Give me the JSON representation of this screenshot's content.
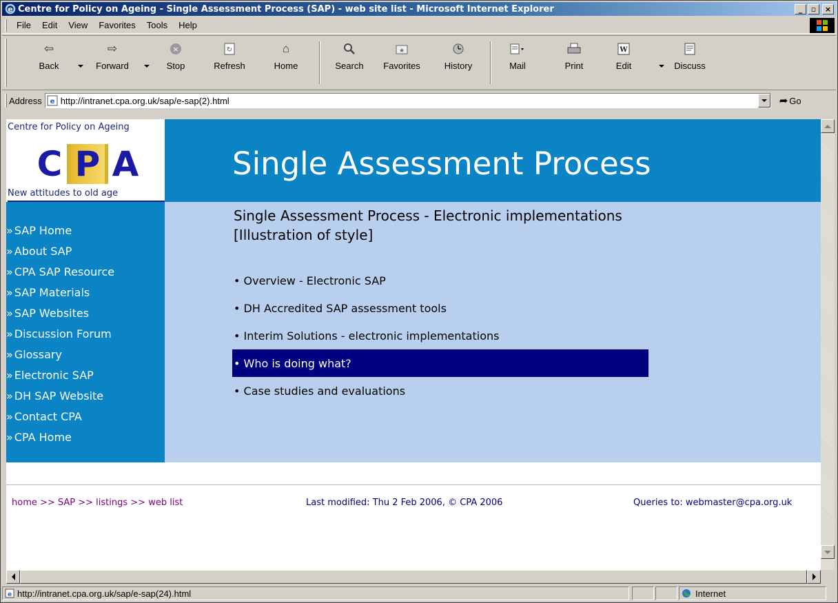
{
  "window": {
    "title": "Centre for Policy on Ageing - Single Assessment Process (SAP) - web site list - Microsoft Internet Explorer",
    "min_label": "_",
    "max_label": "▫",
    "close_label": "×"
  },
  "menu": [
    "File",
    "Edit",
    "View",
    "Favorites",
    "Tools",
    "Help"
  ],
  "toolbar": {
    "back": "Back",
    "forward": "Forward",
    "stop": "Stop",
    "refresh": "Refresh",
    "home": "Home",
    "search": "Search",
    "favorites": "Favorites",
    "history": "History",
    "mail": "Mail",
    "print": "Print",
    "edit": "Edit",
    "discuss": "Discuss"
  },
  "address": {
    "label": "Address",
    "url": "http://intranet.cpa.org.uk/sap/e-sap(2).html",
    "go": "Go"
  },
  "page": {
    "org_name": "Centre for Policy on Ageing",
    "logo_letters": [
      "C",
      "P",
      "A"
    ],
    "tagline": "New attitudes to old age",
    "banner_title": "Single Assessment Process",
    "nav_prefix": "»",
    "nav": [
      "SAP Home",
      "About SAP",
      "CPA SAP Resource",
      "SAP Materials",
      "SAP Websites",
      "Discussion Forum",
      "Glossary",
      "Electronic SAP",
      "DH SAP Website",
      "Contact CPA",
      "CPA Home"
    ],
    "heading": "Single Assessment Process - Electronic implementations",
    "subheading": "[Illustration of style]",
    "links": [
      "• Overview - Electronic SAP",
      "• DH Accredited SAP assessment tools",
      "• Interim Solutions - electronic implementations",
      "• Who is doing what?",
      "• Case studies and evaluations"
    ],
    "footer": {
      "crumbs": "home >> SAP >> listings >> web list",
      "modified": "Last modified: Thu 2 Feb 2006, © CPA 2006",
      "queries": "Queries to: webmaster@cpa.org.uk"
    }
  },
  "status": {
    "url": "http://intranet.cpa.org.uk/sap/e-sap(24).html",
    "zone": "Internet"
  },
  "colors": {
    "banner": "#0a84c4",
    "content": "#b8d0ee",
    "active_link": "#000080",
    "titlebar": "#0a246a"
  }
}
